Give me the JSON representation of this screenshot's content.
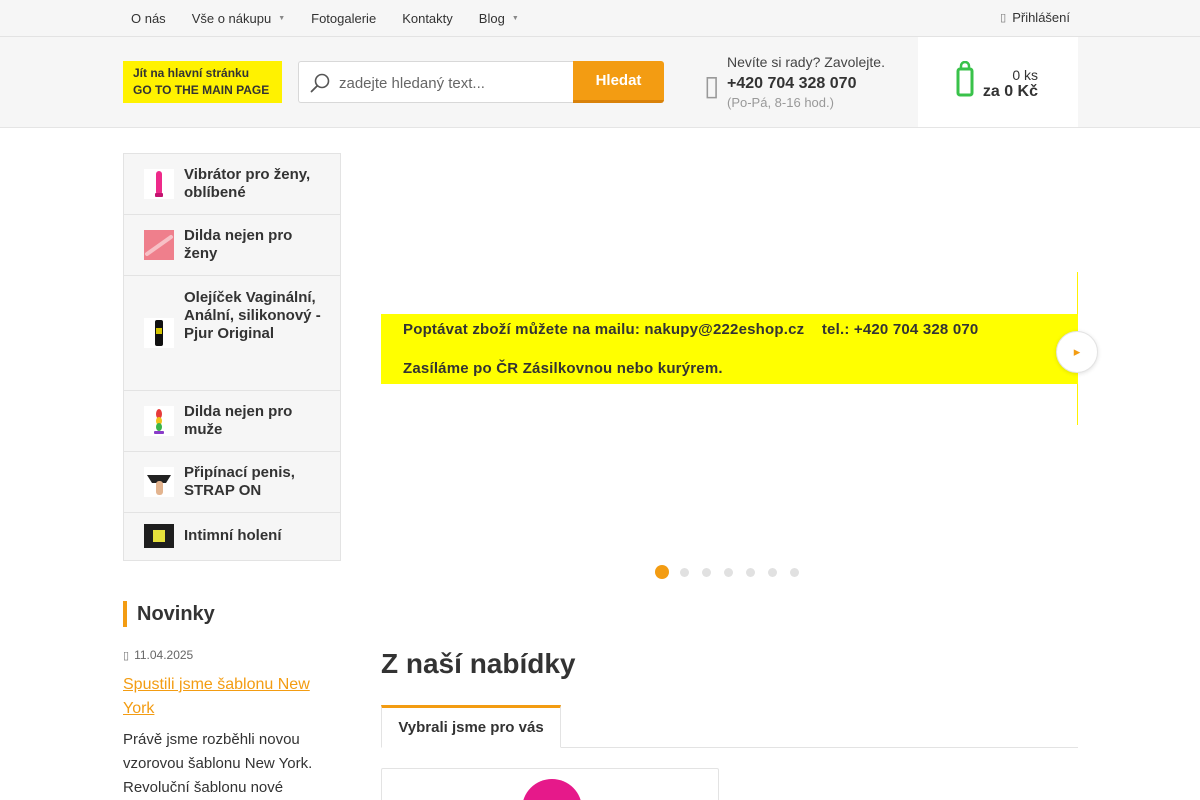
{
  "topnav": {
    "items": [
      {
        "label": "O nás",
        "has_submenu": false
      },
      {
        "label": "Vše o nákupu",
        "has_submenu": true
      },
      {
        "label": "Fotogalerie",
        "has_submenu": false
      },
      {
        "label": "Kontakty",
        "has_submenu": false
      },
      {
        "label": "Blog",
        "has_submenu": true
      }
    ],
    "login_label": "Přihlášení",
    "login_icon": "user-icon"
  },
  "header": {
    "logo_line1": "Jít na hlavní stránku",
    "logo_line2": "GO TO THE MAIN PAGE",
    "search_placeholder": "zadejte hledaný text...",
    "search_button": "Hledat",
    "contact_question": "Nevíte si rady? Zavolejte.",
    "contact_phone": "+420 704 328 070",
    "contact_hours": "(Po-Pá, 8-16 hod.)",
    "cart_count": "0 ks",
    "cart_total": "za 0 Kč",
    "accent_color": "#f39c12"
  },
  "categories": [
    {
      "label": "Vibrátor pro ženy, oblíbené",
      "icon": "vibrator-thumbnail"
    },
    {
      "label": "Dilda nejen pro ženy",
      "icon": "dildo-thumbnail"
    },
    {
      "label": "Olejíček Vaginální, Anální, silikonový - Pjur Original",
      "icon": "lubricant-bottle-thumbnail"
    },
    {
      "label": "Dilda nejen pro muže",
      "icon": "rainbow-plug-thumbnail"
    },
    {
      "label": "Připínací penis, STRAP ON",
      "icon": "strap-on-thumbnail"
    },
    {
      "label": "Intimní holení",
      "icon": "shaving-kit-thumbnail"
    }
  ],
  "news": {
    "heading": "Novinky",
    "date": "11.04.2025",
    "link_title": "Spustili jsme šablonu New York",
    "excerpt": "Právě jsme rozběhli novou vzorovou šablonu New York. Revoluční šablonu nové"
  },
  "carousel": {
    "line1": "Poptávat zboží můžete na mailu: nakupy@222eshop.cz    tel.: +420 704 328 070",
    "line2": "Zasíláme po ČR Zásilkovnou nebo kurýrem.",
    "banner_color": "#ffff00",
    "slide_count": 7,
    "active_slide": 1
  },
  "offer": {
    "heading": "Z naší nabídky",
    "tab_label": "Vybrali jsme pro vás"
  }
}
